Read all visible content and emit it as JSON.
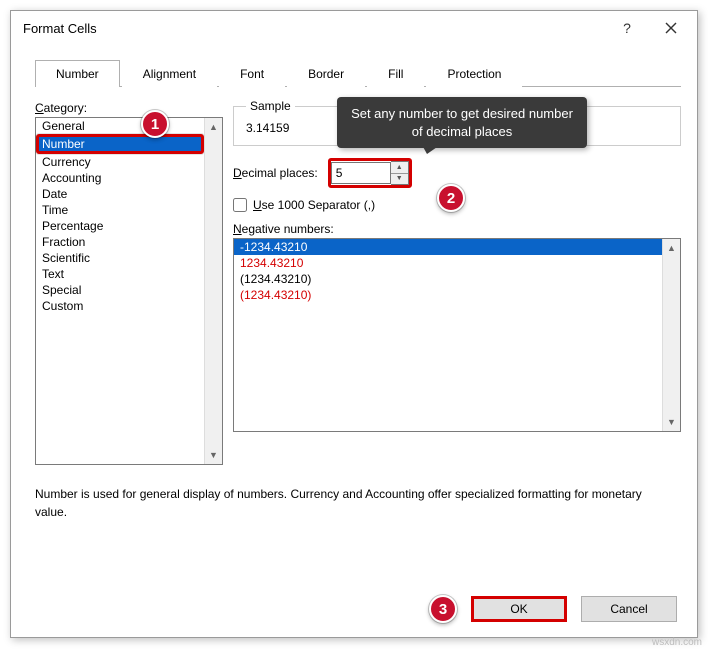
{
  "dialog": {
    "title": "Format Cells"
  },
  "tabs": [
    "Number",
    "Alignment",
    "Font",
    "Border",
    "Fill",
    "Protection"
  ],
  "activeTab": "Number",
  "categoryLabel": "Category:",
  "categories": [
    "General",
    "Number",
    "Currency",
    "Accounting",
    "Date",
    "Time",
    "Percentage",
    "Fraction",
    "Scientific",
    "Text",
    "Special",
    "Custom"
  ],
  "selectedCategory": "Number",
  "sample": {
    "legend": "Sample",
    "value": "3.14159"
  },
  "decimal": {
    "label": "Decimal places:",
    "value": "5"
  },
  "separator": {
    "label": "Use 1000 Separator (,)"
  },
  "negative": {
    "label": "Negative numbers:",
    "items": [
      {
        "text": "-1234.43210",
        "selected": true,
        "red": false
      },
      {
        "text": "1234.43210",
        "selected": false,
        "red": true
      },
      {
        "text": "(1234.43210)",
        "selected": false,
        "red": false
      },
      {
        "text": "(1234.43210)",
        "selected": false,
        "red": true
      }
    ]
  },
  "description": "Number is used for general display of numbers.  Currency and Accounting offer specialized formatting for monetary value.",
  "buttons": {
    "ok": "OK",
    "cancel": "Cancel"
  },
  "tooltip": "Set any number to get desired number of decimal places",
  "badges": {
    "one": "1",
    "two": "2",
    "three": "3"
  },
  "watermark": "wsxdn.com"
}
